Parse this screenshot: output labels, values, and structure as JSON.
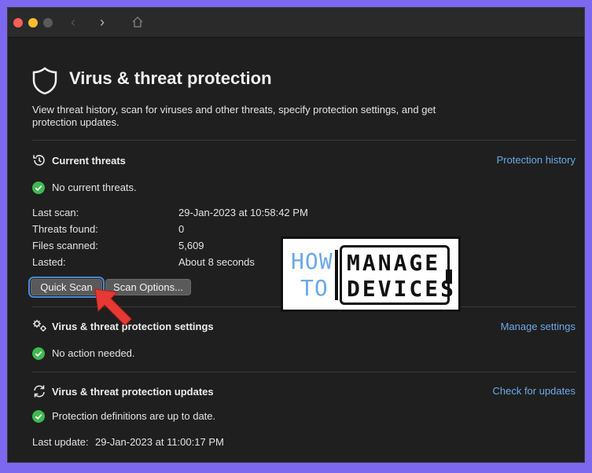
{
  "window": {
    "page": {
      "title": "Virus & threat protection",
      "description": "View threat history, scan for viruses and other threats, specify protection settings, and get protection updates."
    },
    "current_threats": {
      "title": "Current threats",
      "link": "Protection history",
      "status": "No current threats.",
      "rows": [
        {
          "label": "Last scan:",
          "value": "29-Jan-2023 at 10:58:42 PM"
        },
        {
          "label": "Threats found:",
          "value": "0"
        },
        {
          "label": "Files scanned:",
          "value": "5,609"
        },
        {
          "label": "Lasted:",
          "value": "About 8 seconds"
        }
      ],
      "buttons": {
        "quick_scan": "Quick Scan",
        "scan_options": "Scan Options..."
      }
    },
    "settings": {
      "title": "Virus & threat protection settings",
      "link": "Manage settings",
      "status": "No action needed."
    },
    "updates": {
      "title": "Virus & threat protection updates",
      "link": "Check for updates",
      "status": "Protection definitions are up to date.",
      "last_update_label": "Last update:",
      "last_update_value": "29-Jan-2023 at 11:00:17 PM"
    }
  },
  "overlay": {
    "line1": "HOW",
    "line2": "TO",
    "word1": "MANAGE",
    "word2": "DEVICES"
  },
  "colors": {
    "background": "#7b68ee",
    "window": "#1f1f1f",
    "link": "#6aa9e9",
    "success": "#3fb950",
    "arrow": "#e53935"
  },
  "icons": {
    "shield": "shield-icon",
    "history": "history-icon",
    "check": "check-circle-icon",
    "gear": "gears-icon",
    "refresh": "refresh-icon"
  }
}
